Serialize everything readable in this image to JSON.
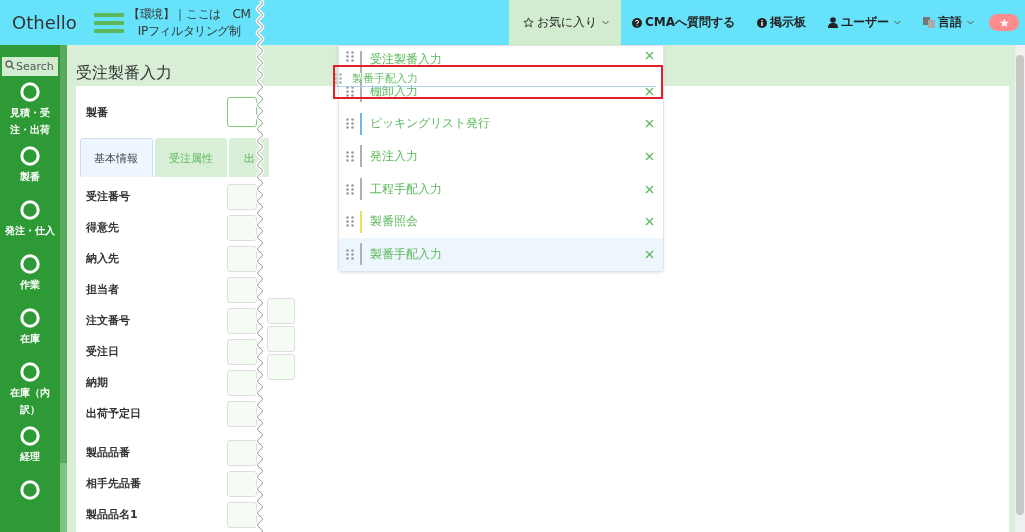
{
  "header": {
    "logo": "Othello",
    "notice_lines": [
      "【環境】｜ここは　CM",
      "IPフィルタリング制"
    ],
    "nav": [
      {
        "label": "お気に入り",
        "kind": "favorites",
        "dropdown": true,
        "selected": true
      },
      {
        "label": "CMAへ質問する",
        "kind": "question",
        "dropdown": false,
        "selected": false
      },
      {
        "label": "掲示板",
        "kind": "info",
        "dropdown": false,
        "selected": false
      },
      {
        "label": "ユーザー",
        "kind": "user",
        "dropdown": true,
        "selected": false
      },
      {
        "label": "言語",
        "kind": "language",
        "dropdown": true,
        "selected": false
      }
    ],
    "star_button": "★"
  },
  "sidebar": {
    "search_placeholder": "Search",
    "items": [
      {
        "kind": "labeled",
        "label": "見積・受注・出荷"
      },
      {
        "kind": "labeled",
        "label": "製番"
      },
      {
        "kind": "labeled",
        "label": "発注・仕入"
      },
      {
        "kind": "labeled",
        "label": "作業"
      },
      {
        "kind": "labeled",
        "label": "在庫"
      },
      {
        "kind": "labeled",
        "label": "在庫（内訳）"
      },
      {
        "kind": "labeled",
        "label": "経理"
      },
      {
        "kind": "icon_only"
      }
    ]
  },
  "page": {
    "title": "受注製番入力",
    "top_field": {
      "label": "製番"
    },
    "tabs": [
      {
        "label": "基本情報",
        "selected": true
      },
      {
        "label": "受注属性",
        "selected": false
      },
      {
        "label": "出",
        "selected": false
      }
    ],
    "fields": [
      {
        "label": "受注番号"
      },
      {
        "label": "得意先"
      },
      {
        "label": "納入先"
      },
      {
        "label": "担当者"
      },
      {
        "label": "注文番号"
      },
      {
        "label": "受注日"
      },
      {
        "label": "納期"
      },
      {
        "label": "出荷予定日"
      },
      {
        "label": "製品品番",
        "group_start": true
      },
      {
        "label": "相手先品番"
      },
      {
        "label": "製品品名1"
      }
    ]
  },
  "favorites_menu": {
    "items": [
      {
        "label": "受注製番入力",
        "color": "#b0b0b0",
        "selected": false
      },
      {
        "label": "棚卸入力",
        "color": "#b0b0b0",
        "selected": false
      },
      {
        "label": "ピッキングリスト発行",
        "color": "#6cb8f0",
        "selected": false
      },
      {
        "label": "発注入力",
        "color": "#b0b0b0",
        "selected": false
      },
      {
        "label": "工程手配入力",
        "color": "#b0b0b0",
        "selected": false
      },
      {
        "label": "製番照会",
        "color": "#e6e05a",
        "selected": false
      },
      {
        "label": "製番手配入力",
        "color": "#b0b0b0",
        "selected": true
      }
    ],
    "dragging": {
      "label": "製番手配入力"
    }
  }
}
